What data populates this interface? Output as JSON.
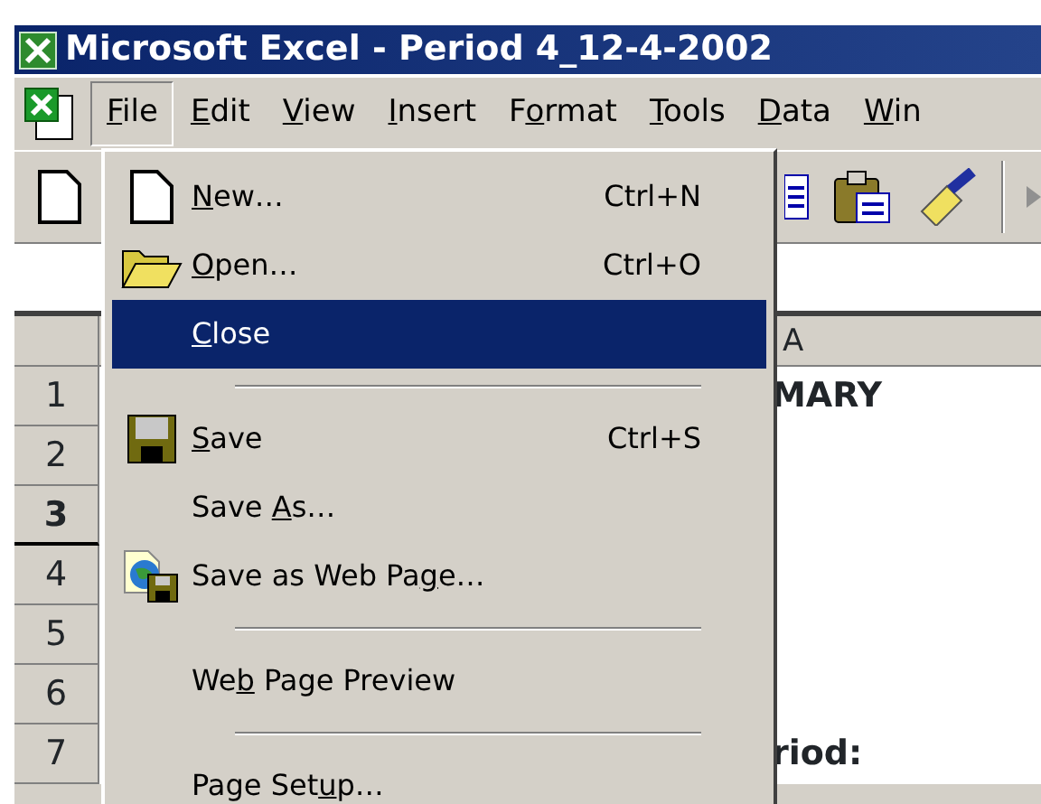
{
  "window": {
    "title": "Microsoft Excel - Period 4_12-4-2002"
  },
  "menu_bar": [
    {
      "key": "F",
      "after": "ile",
      "selected": true
    },
    {
      "key": "E",
      "after": "dit",
      "selected": false
    },
    {
      "key": "V",
      "after": "iew",
      "selected": false
    },
    {
      "key": "I",
      "after": "nsert",
      "selected": false
    },
    {
      "before": "F",
      "key": "o",
      "after": "rmat",
      "selected": false
    },
    {
      "key": "T",
      "after": "ools",
      "selected": false
    },
    {
      "key": "D",
      "after": "ata",
      "selected": false
    },
    {
      "key": "W",
      "after": "in",
      "selected": false
    }
  ],
  "file_menu": [
    {
      "kind": "item",
      "key": "N",
      "after": "ew…",
      "shortcut": "Ctrl+N",
      "selected": false
    },
    {
      "kind": "item",
      "key": "O",
      "after": "pen…",
      "shortcut": "Ctrl+O",
      "selected": false
    },
    {
      "kind": "item",
      "key": "C",
      "after": "lose",
      "selected": true
    },
    {
      "kind": "separator"
    },
    {
      "kind": "item",
      "key": "S",
      "after": "ave",
      "shortcut": "Ctrl+S",
      "selected": false
    },
    {
      "kind": "item",
      "before": "Save ",
      "key": "A",
      "after": "s…",
      "selected": false
    },
    {
      "kind": "item",
      "before": "Save as Web Pa",
      "key": "g",
      "after": "e…",
      "selected": false
    },
    {
      "kind": "separator"
    },
    {
      "kind": "item",
      "before": "We",
      "key": "b",
      "after": " Page Preview",
      "selected": false
    },
    {
      "kind": "separator"
    },
    {
      "kind": "item",
      "before": "Page Set",
      "key": "u",
      "after": "p…",
      "selected": false
    }
  ],
  "sheet": {
    "column_header": "A",
    "rows": [
      {
        "header": "1",
        "cell": "MARY",
        "selected": false
      },
      {
        "header": "2",
        "selected": false
      },
      {
        "header": "3",
        "selected": true
      },
      {
        "header": "4",
        "selected": false
      },
      {
        "header": "5",
        "selected": false
      },
      {
        "header": "6",
        "selected": false
      },
      {
        "header": "7",
        "cell": "riod:",
        "selected": false
      }
    ]
  }
}
